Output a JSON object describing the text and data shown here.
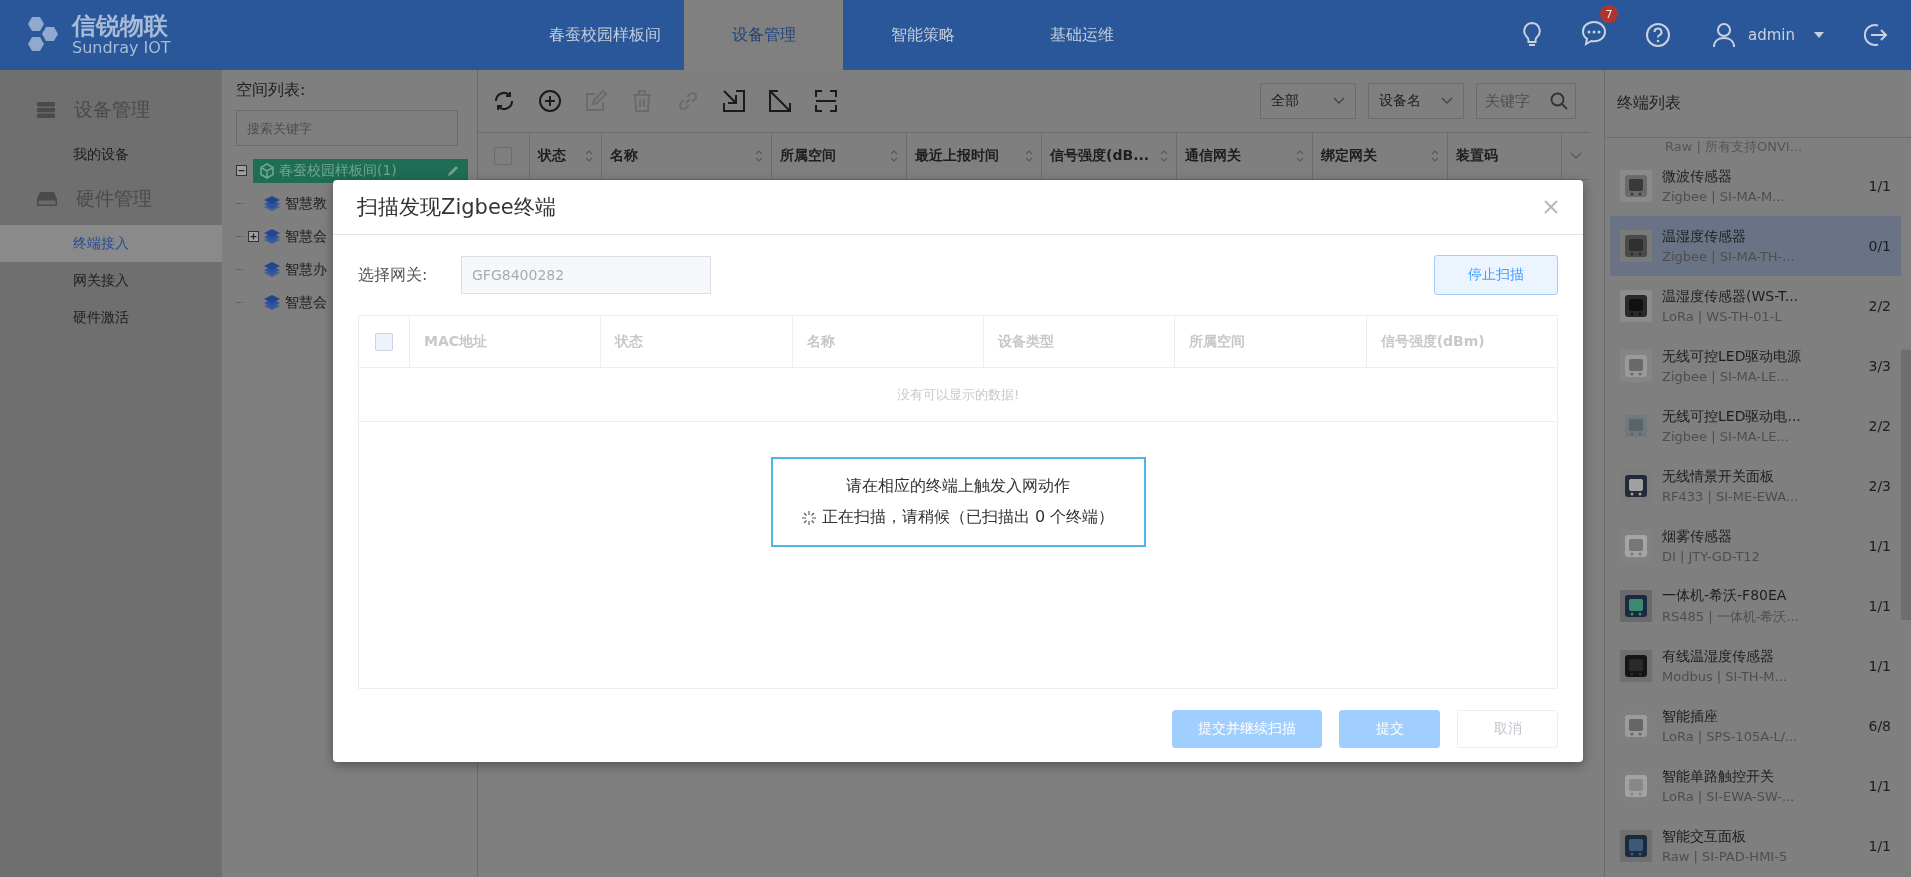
{
  "logo": {
    "name": "信锐物联",
    "subtitle": "Sundray IOT"
  },
  "nav": [
    {
      "label": "春蚕校园样板间",
      "selected": false
    },
    {
      "label": "设备管理",
      "selected": true
    },
    {
      "label": "智能策略",
      "selected": false
    },
    {
      "label": "基础运维",
      "selected": false
    }
  ],
  "header": {
    "message_badge": "7",
    "user": "admin"
  },
  "sidebar": [
    {
      "label": "设备管理",
      "items": [
        {
          "label": "我的设备",
          "selected": false
        }
      ]
    },
    {
      "label": "硬件管理",
      "items": [
        {
          "label": "终端接入",
          "selected": true
        },
        {
          "label": "网关接入",
          "selected": false
        },
        {
          "label": "硬件激活",
          "selected": false
        }
      ]
    }
  ],
  "space_tree": {
    "title": "空间列表:",
    "search": {
      "placeholder": "搜索关键字"
    },
    "nodes": [
      {
        "label": "春蚕校园样板间(1)",
        "expanded": true,
        "selected": true,
        "children": [
          {
            "label": "智慧教",
            "selected": false
          },
          {
            "label": "智慧会",
            "selected": false,
            "expanded": false
          },
          {
            "label": "智慧办",
            "selected": false
          },
          {
            "label": "智慧会",
            "selected": false
          }
        ]
      }
    ]
  },
  "toolbar": {
    "tools": [
      {
        "kind": "refresh",
        "disabled": false
      },
      {
        "kind": "add",
        "disabled": false
      },
      {
        "kind": "edit",
        "disabled": true
      },
      {
        "kind": "delete",
        "disabled": true
      },
      {
        "kind": "link",
        "disabled": true
      },
      {
        "kind": "import",
        "disabled": false
      },
      {
        "kind": "export",
        "disabled": false
      },
      {
        "kind": "scan",
        "disabled": false
      }
    ],
    "filters": [
      {
        "value": "全部"
      },
      {
        "value": "设备名"
      }
    ],
    "search": {
      "placeholder": "关键字"
    }
  },
  "table": {
    "select_all": {
      "checked": false
    },
    "columns": [
      "状态",
      "名称",
      "所属空间",
      "最近上报时间",
      "信号强度(dB...",
      "通信网关",
      "绑定网关",
      "装置码"
    ]
  },
  "terminal_list": {
    "title": "终端列表",
    "cut_item_text": "Raw | 所有支持ONVI...",
    "items": [
      {
        "name": "微波传感器",
        "detail": "Zigbee | SI-MA-M...",
        "count": "1/1",
        "selected": false
      },
      {
        "name": "温湿度传感器",
        "detail": "Zigbee | SI-MA-TH-...",
        "count": "0/1",
        "selected": true
      },
      {
        "name": "温湿度传感器(WS-T...",
        "detail": "LoRa | WS-TH-01-L",
        "count": "2/2",
        "selected": false
      },
      {
        "name": "无线可控LED驱动电源",
        "detail": "Zigbee | SI-MA-LE...",
        "count": "3/3",
        "selected": false
      },
      {
        "name": "无线可控LED驱动电...",
        "detail": "Zigbee | SI-MA-LE...",
        "count": "2/2",
        "selected": false
      },
      {
        "name": "无线情景开关面板",
        "detail": "RF433 | SI-ME-EWA...",
        "count": "2/3",
        "selected": false
      },
      {
        "name": "烟雾传感器",
        "detail": "DI | JTY-GD-T12",
        "count": "1/1",
        "selected": false
      },
      {
        "name": "一体机-希沃-F80EA",
        "detail": "RS485 | 一体机-希沃...",
        "count": "1/1",
        "selected": false
      },
      {
        "name": "有线温湿度传感器",
        "detail": "Modbus | SI-TH-M...",
        "count": "1/1",
        "selected": false
      },
      {
        "name": "智能插座",
        "detail": "LoRa | SPS-105A-L/...",
        "count": "6/8",
        "selected": false
      },
      {
        "name": "智能单路触控开关",
        "detail": "LoRa | SI-EWA-SW-...",
        "count": "1/1",
        "selected": false
      },
      {
        "name": "智能交互面板",
        "detail": "Raw | SI-PAD-HMI-5",
        "count": "1/1",
        "selected": false
      }
    ]
  },
  "dialog": {
    "title": "扫描发现Zigbee终端",
    "gateway_label": "选择网关:",
    "gateway_value": "GFG8400282",
    "stop_button": {
      "label": "停止扫描",
      "disabled": false
    },
    "select_all": {
      "checked": false
    },
    "columns": [
      "MAC地址",
      "状态",
      "名称",
      "设备类型",
      "所属空间",
      "信号强度(dBm)"
    ],
    "empty_text": "没有可以显示的数据!",
    "scan_hint": "请在相应的终端上触发入网动作",
    "scan_status": "正在扫描，请稍候（已扫描出 0 个终端）",
    "buttons": [
      {
        "label": "提交并继续扫描",
        "kind": "primary",
        "disabled": true
      },
      {
        "label": "提交",
        "kind": "primary",
        "disabled": true
      },
      {
        "label": "取消",
        "kind": "default",
        "disabled": true
      }
    ]
  }
}
